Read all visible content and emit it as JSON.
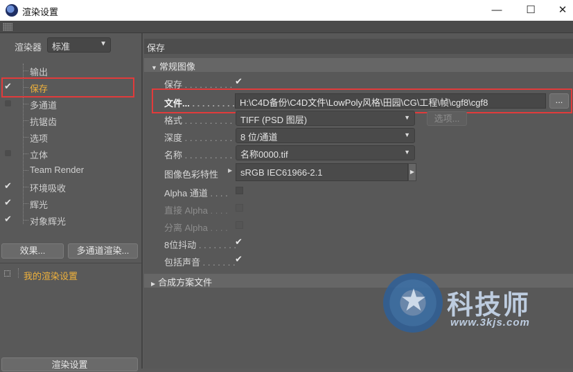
{
  "window": {
    "title": "渲染设置",
    "controls": {
      "minimize": "—",
      "maximize": "☐",
      "close": "✕"
    }
  },
  "left": {
    "renderer_label": "渲染器",
    "renderer_value": "标准",
    "items": [
      {
        "label": "输出",
        "state": "none"
      },
      {
        "label": "保存",
        "state": "checked",
        "active": true
      },
      {
        "label": "多通道",
        "state": "unchecked"
      },
      {
        "label": "抗锯齿",
        "state": "none"
      },
      {
        "label": "选项",
        "state": "none"
      },
      {
        "label": "立体",
        "state": "unchecked"
      },
      {
        "label": "Team Render",
        "state": "none"
      },
      {
        "label": "环境吸收",
        "state": "checked"
      },
      {
        "label": "辉光",
        "state": "checked"
      },
      {
        "label": "对象辉光",
        "state": "checked"
      }
    ],
    "effects_button": "效果...",
    "multipass_button": "多通道渲染...",
    "preset_label": "我的渲染设置",
    "render_settings_button": "渲染设置"
  },
  "right": {
    "header": "保存",
    "group_general": "常规图像",
    "fields": {
      "save": {
        "label": "保存",
        "dots": " . . . . . . . . . .",
        "checked": true
      },
      "file": {
        "label": "文件...",
        "dots": " . . . . . . . . . .",
        "value": "H:\\C4D备份\\C4D文件\\LowPoly风格\\田园\\CG\\工程\\帧\\cgf8\\cgf8",
        "browse": "..."
      },
      "format": {
        "label": "格式",
        "dots": " . . . . . . . . . .",
        "value": "TIFF (PSD 图层)",
        "options_button": "选项..."
      },
      "depth": {
        "label": "深度",
        "dots": " . . . . . . . . . .",
        "value": "8 位/通道"
      },
      "name": {
        "label": "名称",
        "dots": " . . . . . . . . . .",
        "value": "名称0000.tif"
      },
      "color_profile": {
        "label": "图像色彩特性",
        "value": "sRGB IEC61966-2.1"
      },
      "alpha": {
        "label": "Alpha 通道",
        "dots": " . . . .",
        "checked": false
      },
      "straight_alpha": {
        "label": "直接 Alpha",
        "dots": " . . . .",
        "checked": false,
        "disabled": true
      },
      "separate_alpha": {
        "label": "分离 Alpha",
        "dots": " . . . .",
        "checked": false,
        "disabled": true
      },
      "dither": {
        "label": "8位抖动",
        "dots": " . . . . . . . .",
        "checked": true
      },
      "sound": {
        "label": "包括声音",
        "dots": " . . . . . . .",
        "checked": true
      }
    },
    "group_compositing": "合成方案文件"
  },
  "watermark": {
    "name": "科技师",
    "url": "www.3kjs.com"
  }
}
